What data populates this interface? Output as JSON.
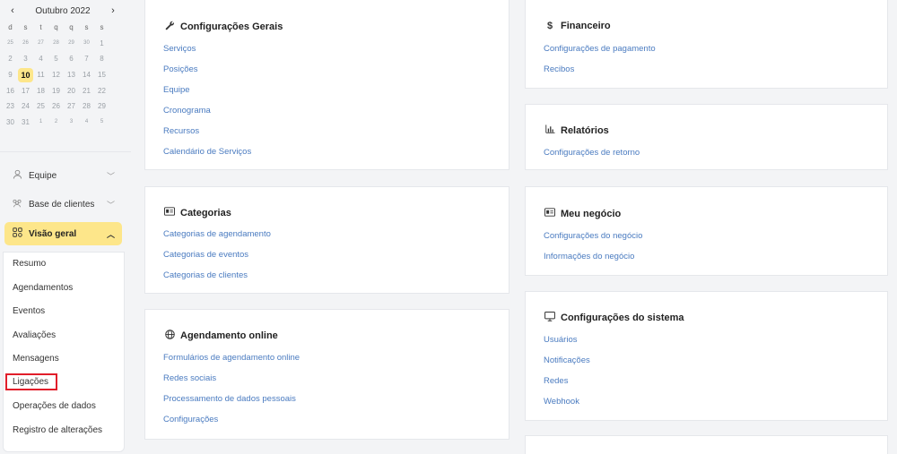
{
  "calendar": {
    "month_label": "Outubro 2022",
    "prev_icon": "‹",
    "next_icon": "›",
    "weekdays": [
      "d",
      "s",
      "t",
      "q",
      "q",
      "s",
      "s"
    ],
    "weeks": [
      [
        "25",
        "26",
        "27",
        "28",
        "29",
        "30",
        "1"
      ],
      [
        "2",
        "3",
        "4",
        "5",
        "6",
        "7",
        "8"
      ],
      [
        "9",
        "10",
        "11",
        "12",
        "13",
        "14",
        "15"
      ],
      [
        "16",
        "17",
        "18",
        "19",
        "20",
        "21",
        "22"
      ],
      [
        "23",
        "24",
        "25",
        "26",
        "27",
        "28",
        "29"
      ],
      [
        "30",
        "31",
        "1",
        "2",
        "3",
        "4",
        "5"
      ]
    ],
    "selected_day": "10"
  },
  "sidebar": {
    "equipe_label": "Equipe",
    "clientes_label": "Base de clientes",
    "visao_label": "Visão geral",
    "chevron_down": "﹀",
    "chevron_up": "︿",
    "submenu": [
      "Resumo",
      "Agendamentos",
      "Eventos",
      "Avaliações",
      "Mensagens",
      "Ligações",
      "Operações de dados",
      "Registro de alterações"
    ]
  },
  "cards": {
    "config_gerais": {
      "title": "Configurações Gerais",
      "icon": "wrench-icon",
      "links": [
        "Serviços",
        "Posições",
        "Equipe",
        "Cronograma",
        "Recursos",
        "Calendário de Serviços"
      ]
    },
    "categorias": {
      "title": "Categorias",
      "icon": "id-card-icon",
      "links": [
        "Categorias de agendamento",
        "Categorias de eventos",
        "Categorias de clientes"
      ]
    },
    "agendamento_online": {
      "title": "Agendamento online",
      "icon": "globe-icon",
      "links": [
        "Formulários de agendamento online",
        "Redes sociais",
        "Processamento de dados pessoais",
        "Configurações"
      ]
    },
    "financeiro": {
      "title": "Financeiro",
      "icon": "dollar-icon",
      "links": [
        "Configurações de pagamento",
        "Recibos"
      ]
    },
    "relatorios": {
      "title": "Relatórios",
      "icon": "bar-chart-icon",
      "links": [
        "Configurações de retorno"
      ]
    },
    "meu_negocio": {
      "title": "Meu negócio",
      "icon": "id-card-icon",
      "links": [
        "Configurações do negócio",
        "Informações do negócio"
      ]
    },
    "config_sistema": {
      "title": "Configurações do sistema",
      "icon": "monitor-icon",
      "links": [
        "Usuários",
        "Notificações",
        "Redes",
        "Webhook"
      ]
    }
  },
  "colors": {
    "accent": "#fde68a",
    "link": "#4a7bc0",
    "highlight_border": "#e11d2a"
  }
}
